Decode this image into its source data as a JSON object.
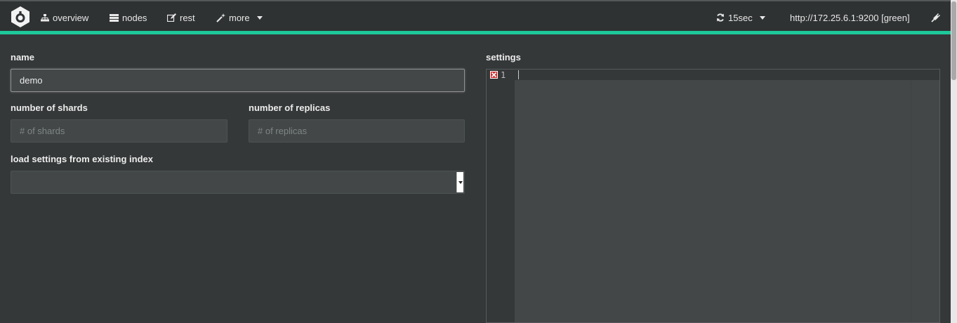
{
  "nav": {
    "items": [
      {
        "label": "overview",
        "icon": "sitemap-icon"
      },
      {
        "label": "nodes",
        "icon": "server-icon"
      },
      {
        "label": "rest",
        "icon": "edit-icon"
      },
      {
        "label": "more",
        "icon": "magic-wand-icon"
      }
    ],
    "refresh": {
      "label": "15sec",
      "icon": "refresh-icon"
    },
    "cluster_url": "http://172.25.6.1:9200 [green]",
    "connect_icon": "plug-icon",
    "accent_color": "#1ec99b"
  },
  "form": {
    "name": {
      "label": "name",
      "value": "demo"
    },
    "shards": {
      "label": "number of shards",
      "placeholder": "# of shards",
      "value": ""
    },
    "replicas": {
      "label": "number of replicas",
      "placeholder": "# of replicas",
      "value": ""
    },
    "load_settings": {
      "label": "load settings from existing index",
      "selected": ""
    }
  },
  "settings": {
    "label": "settings",
    "line_number": "1",
    "error_icon": "error-x-icon"
  }
}
